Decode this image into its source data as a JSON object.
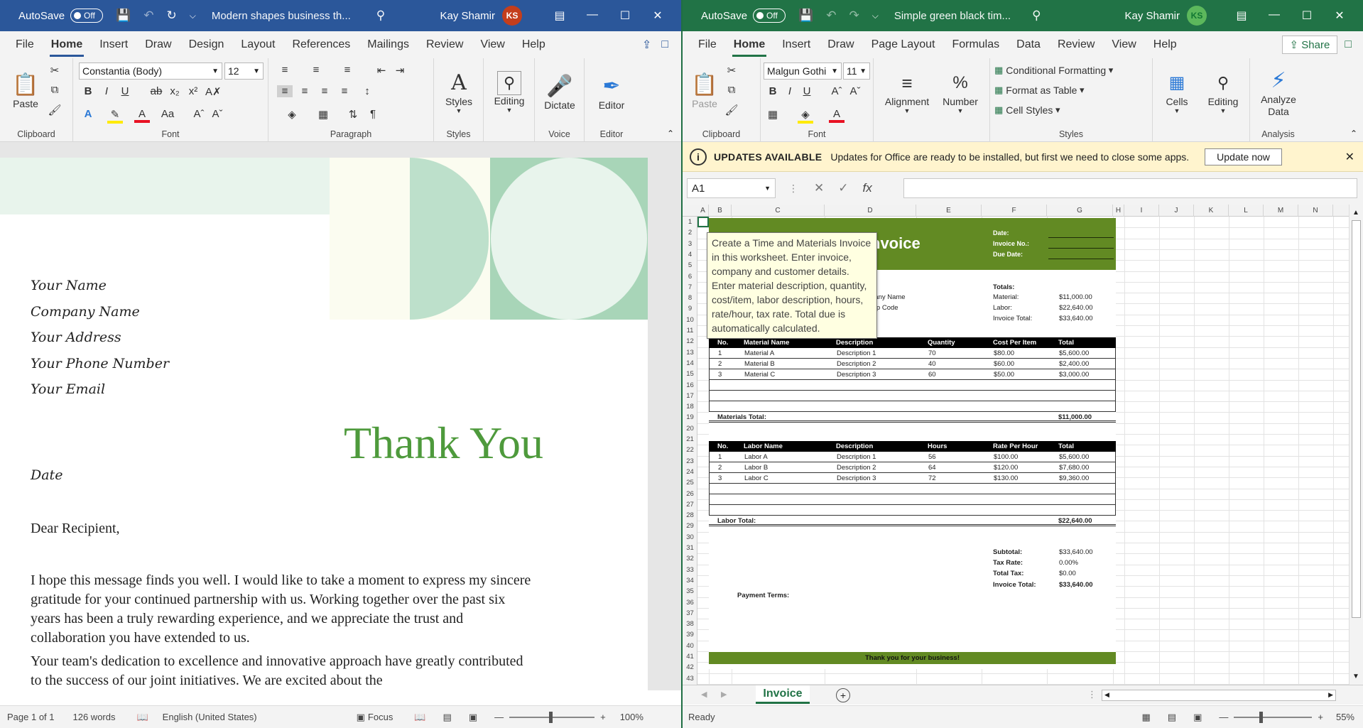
{
  "word": {
    "autosave": "AutoSave",
    "toggle": "Off",
    "title": "Modern shapes business th...",
    "user": "Kay Shamir",
    "initials": "KS",
    "menu": [
      "File",
      "Home",
      "Insert",
      "Draw",
      "Design",
      "Layout",
      "References",
      "Mailings",
      "Review",
      "View",
      "Help"
    ],
    "font_name": "Constantia (Body)",
    "font_size": "12",
    "groups": {
      "clipboard": "Clipboard",
      "font": "Font",
      "paragraph": "Paragraph",
      "styles": "Styles",
      "voice": "Voice",
      "editor": "Editor"
    },
    "buttons": {
      "paste": "Paste",
      "styles": "Styles",
      "editing": "Editing",
      "dictate": "Dictate",
      "editor": "Editor"
    },
    "sender": [
      "Your Name",
      "Company Name",
      "Your Address",
      "Your Phone Number",
      "Your Email"
    ],
    "thanks": "Thank You",
    "date": "Date",
    "salutation": "Dear Recipient,",
    "para1": "I hope this message finds you well. I would like to take a moment to express my sincere gratitude for your continued partnership with us. Working together over the past six years has been a truly rewarding experience, and we appreciate the trust and collaboration you have extended to us.",
    "para2": "Your team's dedication to excellence and innovative approach have greatly contributed to the success of our joint initiatives. We are excited about the",
    "status": {
      "page": "Page 1 of 1",
      "words": "126 words",
      "lang": "English (United States)",
      "focus": "Focus",
      "zoom": "100%"
    }
  },
  "excel": {
    "autosave": "AutoSave",
    "toggle": "Off",
    "title": "Simple green  black tim...",
    "user": "Kay Shamir",
    "initials": "KS",
    "menu": [
      "File",
      "Home",
      "Insert",
      "Draw",
      "Page Layout",
      "Formulas",
      "Data",
      "Review",
      "View",
      "Help"
    ],
    "share": "Share",
    "font_name": "Malgun Gothi",
    "font_size": "11",
    "groups": {
      "clipboard": "Clipboard",
      "font": "Font",
      "styles": "Styles",
      "analysis": "Analysis"
    },
    "buttons": {
      "paste": "Paste",
      "alignment": "Alignment",
      "number": "Number",
      "cond": "Conditional Formatting",
      "table": "Format as Table",
      "cellstyles": "Cell Styles",
      "cells": "Cells",
      "editing": "Editing",
      "analyze": "Analyze Data"
    },
    "info": {
      "title": "UPDATES AVAILABLE",
      "text": "Updates for Office are ready to be installed, but first we need to close some apps.",
      "button": "Update now"
    },
    "namebox": "A1",
    "columns": [
      "A",
      "B",
      "C",
      "D",
      "E",
      "F",
      "G",
      "H",
      "I",
      "J",
      "K",
      "L",
      "M",
      "N"
    ],
    "tooltip": "Create a Time and Materials Invoice in this worksheet. Enter invoice, company and customer details. Enter material description, quantity, cost/item, labor description, hours, rate/hour, tax rate. Total due is automatically calculated.",
    "invoice": {
      "title": "nvoice",
      "date": "Date:",
      "invoice_no": "Invoice No.:",
      "due": "Due Date:",
      "company_frag": "pany Name",
      "zip_frag": "Zip Code",
      "totals": "Totals:",
      "material": "Material:",
      "material_val": "$11,000.00",
      "labor": "Labor:",
      "labor_val": "$22,640.00",
      "inv_total": "Invoice Total:",
      "inv_total_val": "$33,640.00",
      "mat_head": [
        "No.",
        "Material Name",
        "Description",
        "Quantity",
        "Cost Per Item",
        "Total"
      ],
      "mat_rows": [
        [
          "1",
          "Material A",
          "Description 1",
          "70",
          "$80.00",
          "$5,600.00"
        ],
        [
          "2",
          "Material B",
          "Description 2",
          "40",
          "$60.00",
          "$2,400.00"
        ],
        [
          "3",
          "Material C",
          "Description 3",
          "60",
          "$50.00",
          "$3,000.00"
        ]
      ],
      "mat_total_label": "Materials Total:",
      "mat_total": "$11,000.00",
      "lab_head": [
        "No.",
        "Labor Name",
        "Description",
        "Hours",
        "Rate Per Hour",
        "Total"
      ],
      "lab_rows": [
        [
          "1",
          "Labor A",
          "Description 1",
          "56",
          "$100.00",
          "$5,600.00"
        ],
        [
          "2",
          "Labor B",
          "Description 2",
          "64",
          "$120.00",
          "$7,680.00"
        ],
        [
          "3",
          "Labor C",
          "Description 3",
          "72",
          "$130.00",
          "$9,360.00"
        ]
      ],
      "lab_total_label": "Labor Total:",
      "lab_total": "$22,640.00",
      "subtotal": "Subtotal:",
      "subtotal_val": "$33,640.00",
      "taxrate": "Tax Rate:",
      "taxrate_val": "0.00%",
      "totaltax": "Total Tax:",
      "totaltax_val": "$0.00",
      "invtotal2": "Invoice Total:",
      "invtotal2_val": "$33,640.00",
      "payment": "Payment Terms:",
      "footer": "Thank you for your business!"
    },
    "sheet_tab": "Invoice",
    "status": {
      "ready": "Ready",
      "zoom": "55%"
    }
  }
}
